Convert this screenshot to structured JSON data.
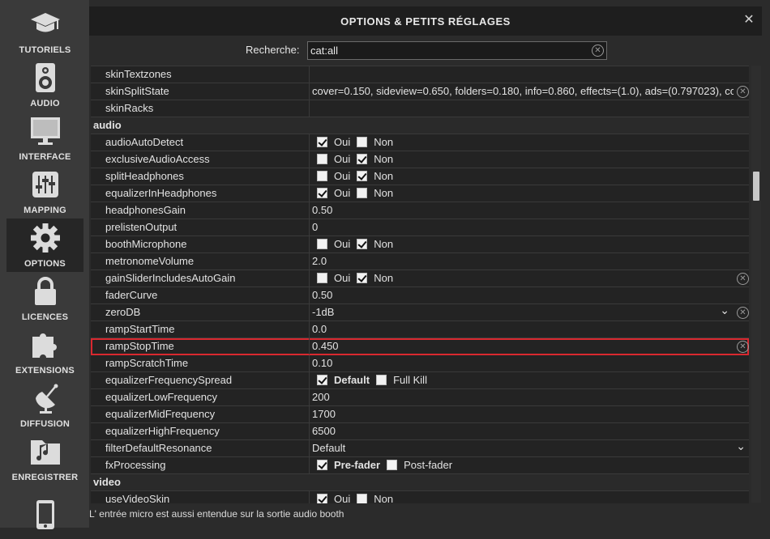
{
  "sidebar": {
    "items": [
      {
        "label": "TUTORIELS",
        "icon": "graduation-cap-icon"
      },
      {
        "label": "AUDIO",
        "icon": "speaker-icon"
      },
      {
        "label": "INTERFACE",
        "icon": "monitor-icon"
      },
      {
        "label": "MAPPING",
        "icon": "mixer-sliders-icon"
      },
      {
        "label": "OPTIONS",
        "icon": "gear-icon"
      },
      {
        "label": "LICENCES",
        "icon": "lock-icon"
      },
      {
        "label": "EXTENSIONS",
        "icon": "puzzle-icon"
      },
      {
        "label": "DIFFUSION",
        "icon": "broadcast-icon"
      },
      {
        "label": "ENREGISTRER",
        "icon": "music-folder-icon"
      },
      {
        "label": "",
        "icon": "phone-icon"
      }
    ],
    "active_index": 4
  },
  "dialog": {
    "title": "OPTIONS & PETITS RÉGLAGES",
    "close_glyph": "✕"
  },
  "search": {
    "label": "Recherche:",
    "value": "cat:all"
  },
  "rows": [
    {
      "type": "option",
      "name": "skinTextzones",
      "kind": "text",
      "value": ""
    },
    {
      "type": "option",
      "name": "skinSplitState",
      "kind": "text",
      "value": "cover=0.150, sideview=0.650, folders=0.180, info=0.860, effects=(1.0), ads=(0.797023), co",
      "clear": true
    },
    {
      "type": "option",
      "name": "skinRacks",
      "kind": "text",
      "value": ""
    },
    {
      "type": "category",
      "name": "audio"
    },
    {
      "type": "option",
      "name": "audioAutoDetect",
      "kind": "bool",
      "opts": [
        "Oui",
        "Non"
      ],
      "checked": 0
    },
    {
      "type": "option",
      "name": "exclusiveAudioAccess",
      "kind": "bool",
      "opts": [
        "Oui",
        "Non"
      ],
      "checked": 1
    },
    {
      "type": "option",
      "name": "splitHeadphones",
      "kind": "bool",
      "opts": [
        "Oui",
        "Non"
      ],
      "checked": 1
    },
    {
      "type": "option",
      "name": "equalizerInHeadphones",
      "kind": "bool",
      "opts": [
        "Oui",
        "Non"
      ],
      "checked": 0
    },
    {
      "type": "option",
      "name": "headphonesGain",
      "kind": "text",
      "value": "0.50"
    },
    {
      "type": "option",
      "name": "prelistenOutput",
      "kind": "text",
      "value": "0"
    },
    {
      "type": "option",
      "name": "boothMicrophone",
      "kind": "bool",
      "opts": [
        "Oui",
        "Non"
      ],
      "checked": 1
    },
    {
      "type": "option",
      "name": "metronomeVolume",
      "kind": "text",
      "value": "2.0"
    },
    {
      "type": "option",
      "name": "gainSliderIncludesAutoGain",
      "kind": "bool",
      "opts": [
        "Oui",
        "Non"
      ],
      "checked": 1,
      "clear": true
    },
    {
      "type": "option",
      "name": "faderCurve",
      "kind": "text",
      "value": "0.50"
    },
    {
      "type": "option",
      "name": "zeroDB",
      "kind": "select",
      "value": "-1dB",
      "clear": true
    },
    {
      "type": "option",
      "name": "rampStartTime",
      "kind": "text",
      "value": "0.0"
    },
    {
      "type": "option",
      "name": "rampStopTime",
      "kind": "text",
      "value": "0.450",
      "clear": true,
      "highlight": true
    },
    {
      "type": "option",
      "name": "rampScratchTime",
      "kind": "text",
      "value": "0.10"
    },
    {
      "type": "option",
      "name": "equalizerFrequencySpread",
      "kind": "bool",
      "opts": [
        "Default",
        "Full Kill"
      ],
      "checked": 0,
      "bold_checked": true
    },
    {
      "type": "option",
      "name": "equalizerLowFrequency",
      "kind": "text",
      "value": "200"
    },
    {
      "type": "option",
      "name": "equalizerMidFrequency",
      "kind": "text",
      "value": "1700"
    },
    {
      "type": "option",
      "name": "equalizerHighFrequency",
      "kind": "text",
      "value": "6500"
    },
    {
      "type": "option",
      "name": "filterDefaultResonance",
      "kind": "select",
      "value": "Default"
    },
    {
      "type": "option",
      "name": "fxProcessing",
      "kind": "bool",
      "opts": [
        "Pre-fader",
        "Post-fader"
      ],
      "checked": 0,
      "bold_checked": true
    },
    {
      "type": "category",
      "name": "video"
    },
    {
      "type": "option",
      "name": "useVideoSkin",
      "kind": "bool",
      "opts": [
        "Oui",
        "Non"
      ],
      "checked": 0
    }
  ],
  "scroll": {
    "position_fraction": 0.26
  },
  "status": {
    "text": "L' entrée micro est aussi entendue sur la sortie audio booth"
  }
}
